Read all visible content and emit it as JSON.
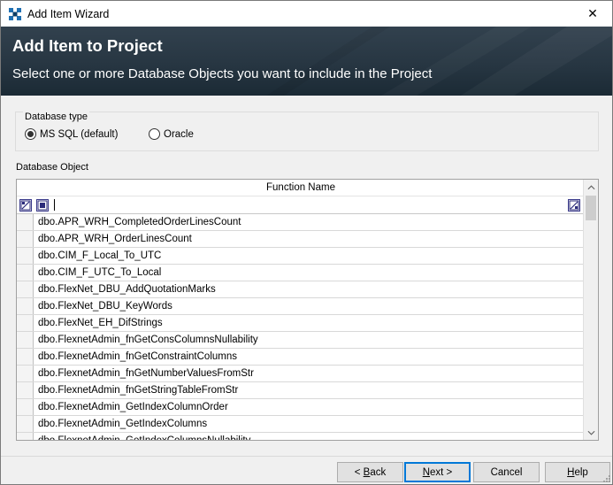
{
  "window": {
    "title": "Add Item Wizard",
    "close_glyph": "✕",
    "icon": "wizard-app-icon"
  },
  "banner": {
    "title": "Add Item to Project",
    "subtitle": "Select one or more Database Objects you want to include in the Project"
  },
  "database_type": {
    "legend": "Database type",
    "options": [
      {
        "label": "MS SQL (default)",
        "selected": true
      },
      {
        "label": "Oracle",
        "selected": false
      }
    ]
  },
  "objects": {
    "label": "Database Object",
    "column_header": "Function Name",
    "filter_value": "",
    "rows": [
      "dbo.APR_WRH_CompletedOrderLinesCount",
      "dbo.APR_WRH_OrderLinesCount",
      "dbo.CIM_F_Local_To_UTC",
      "dbo.CIM_F_UTC_To_Local",
      "dbo.FlexNet_DBU_AddQuotationMarks",
      "dbo.FlexNet_DBU_KeyWords",
      "dbo.FlexNet_EH_DifStrings",
      "dbo.FlexnetAdmin_fnGetConsColumnsNullability",
      "dbo.FlexnetAdmin_fnGetConstraintColumns",
      "dbo.FlexnetAdmin_fnGetNumberValuesFromStr",
      "dbo.FlexnetAdmin_fnGetStringTableFromStr",
      "dbo.FlexnetAdmin_GetIndexColumnOrder",
      "dbo.FlexnetAdmin_GetIndexColumns",
      "dbo.FlexnetAdmin_GetIndexColumnsNullability"
    ],
    "scroll_up_glyph": "⌃",
    "scroll_down_glyph": "⌄"
  },
  "buttons": {
    "back": {
      "prefix": "< ",
      "mnemonic": "B",
      "rest": "ack"
    },
    "next": {
      "prefix": "",
      "mnemonic": "N",
      "rest": "ext >"
    },
    "cancel": {
      "label": "Cancel"
    },
    "help": {
      "prefix": "",
      "mnemonic": "H",
      "rest": "elp"
    }
  },
  "colors": {
    "banner_bg": "#273642",
    "default_button_border": "#0078d7",
    "window_bg": "#f0f0f0"
  }
}
